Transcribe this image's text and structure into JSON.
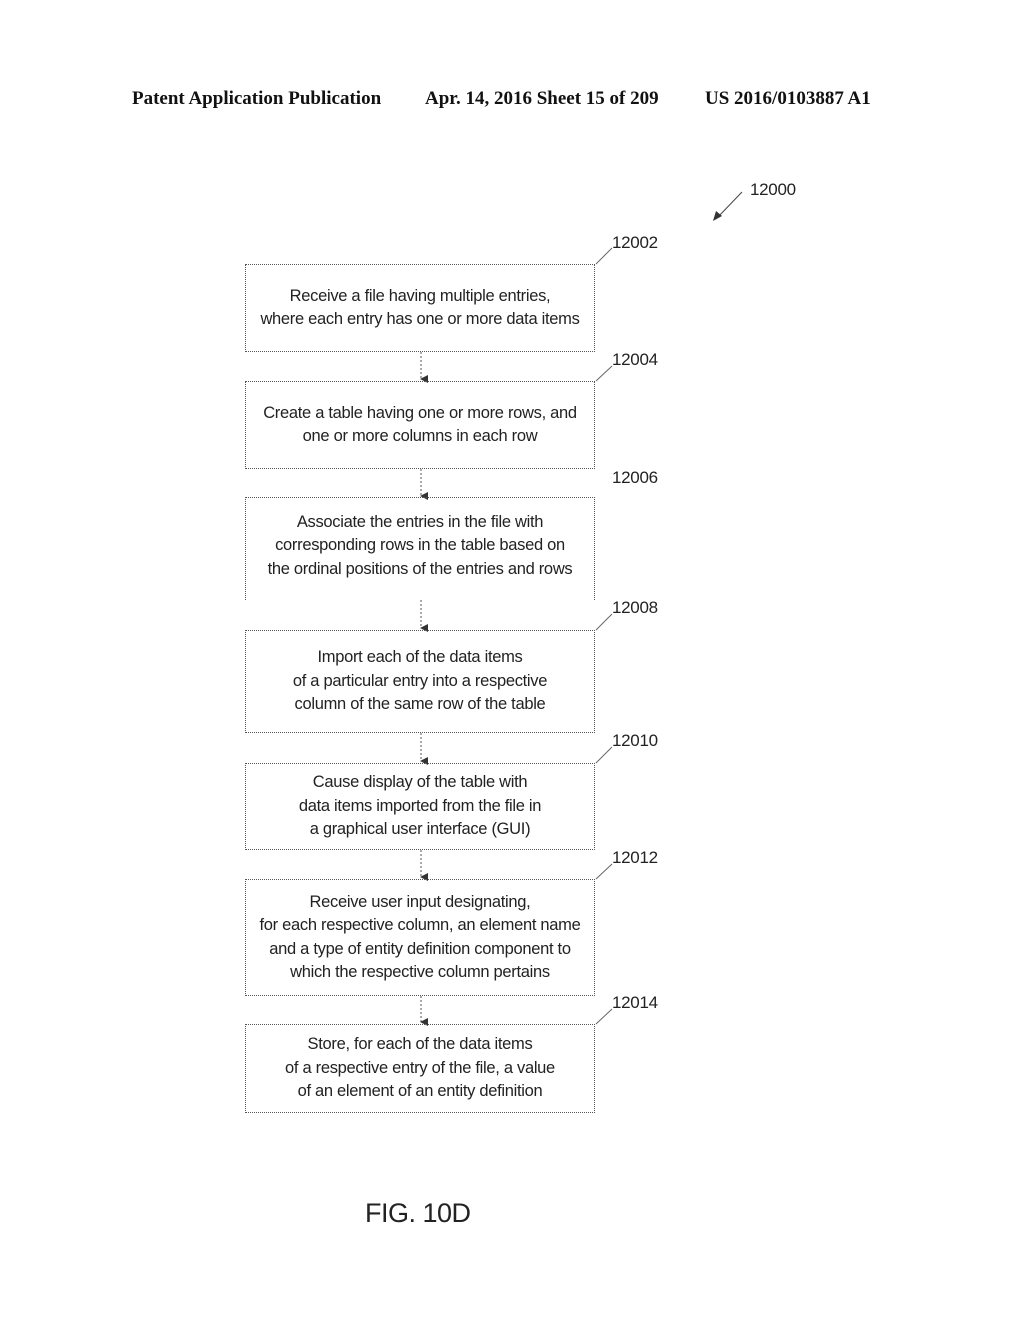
{
  "header": {
    "publication": "Patent Application Publication",
    "date_sheet": "Apr. 14, 2016  Sheet 15 of 209",
    "patent_number": "US 2016/0103887 A1"
  },
  "figure": {
    "reference": "12000",
    "caption": "FIG. 10D"
  },
  "steps": [
    {
      "ref": "12002",
      "text": "Receive a file having multiple entries,\nwhere each entry has one or more data items"
    },
    {
      "ref": "12004",
      "text": "Create a table having one or more rows, and\none or more columns in each row"
    },
    {
      "ref": "12006",
      "text": "Associate the entries in the file with\ncorresponding rows in the table based on\nthe ordinal positions of the entries and rows"
    },
    {
      "ref": "12008",
      "text": "Import each of the data items\nof a particular entry into a respective\ncolumn of the same row of the table"
    },
    {
      "ref": "12010",
      "text": "Cause display of the table with\ndata items imported from the file in\na graphical user interface (GUI)"
    },
    {
      "ref": "12012",
      "text": "Receive user input designating,\nfor each respective column, an element name\nand a type of entity definition component to\nwhich the respective column pertains"
    },
    {
      "ref": "12014",
      "text": "Store, for each of the data items\nof a respective entry of the file, a value\nof an element  of an entity definition"
    }
  ]
}
